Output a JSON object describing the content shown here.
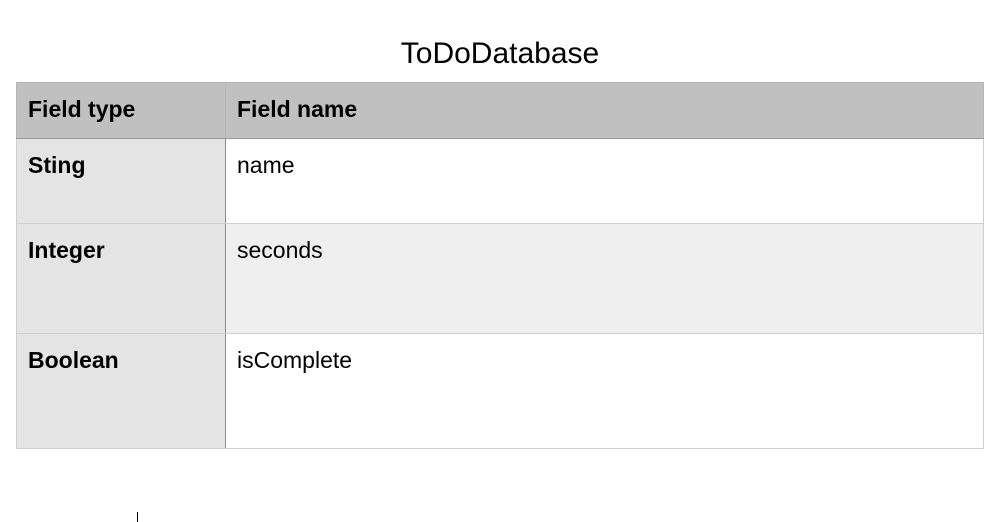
{
  "document": {
    "title": "ToDoDatabase"
  },
  "table": {
    "headers": {
      "field_type": "Field type",
      "field_name": "Field name"
    },
    "rows": [
      {
        "type": "Sting",
        "name": "name"
      },
      {
        "type": "Integer",
        "name": "seconds"
      },
      {
        "type": "Boolean",
        "name": "isComplete"
      }
    ]
  },
  "colors": {
    "header_bg": "#bfc0bf",
    "type_column_bg": "#e3e4e3",
    "alt_row_bg": "#efefef"
  }
}
